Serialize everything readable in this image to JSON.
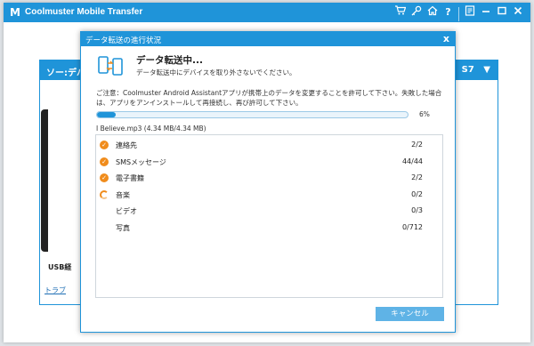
{
  "app": {
    "title": "Coolmuster Mobile Transfer",
    "logo_text": "M",
    "icons": [
      "cart-icon",
      "key-icon",
      "home-icon",
      "help-icon",
      "feedback-icon",
      "minimize-icon",
      "maximize-icon",
      "close-icon"
    ]
  },
  "background": {
    "panel_left_text": "ソー:デバ",
    "panel_right_text": "S7",
    "panel_dropdown": "▼",
    "usb_text": "USB経",
    "trouble_link": "トラブ"
  },
  "dialog": {
    "title": "データ転送の進行状況",
    "close": "x",
    "heading": "データ転送中...",
    "subheading": "データ転送中にデバイスを取り外さないでください。",
    "note": "ご注意：Coolmuster Android Assistantアプリが携帯上のデータを変更することを許可して下さい。失敗した場合は、アプリをアンインストールして再接続し、再び許可して下さい。",
    "progress": 6,
    "progress_label": "6%",
    "current_file": "I Believe.mp3  (4.34 MB/4.34 MB)",
    "items": [
      {
        "label": "連絡先",
        "count": "2/2",
        "status": "done"
      },
      {
        "label": "SMSメッセージ",
        "count": "44/44",
        "status": "done"
      },
      {
        "label": "電子書籍",
        "count": "2/2",
        "status": "done"
      },
      {
        "label": "音楽",
        "count": "0/2",
        "status": "in-progress"
      },
      {
        "label": "ビデオ",
        "count": "0/3",
        "status": "pending"
      },
      {
        "label": "写真",
        "count": "0/712",
        "status": "pending"
      }
    ],
    "cancel_label": "キャンセル"
  },
  "colors": {
    "accent": "#1f94d9",
    "check": "#f08c1c",
    "button": "#5fb3e6"
  }
}
